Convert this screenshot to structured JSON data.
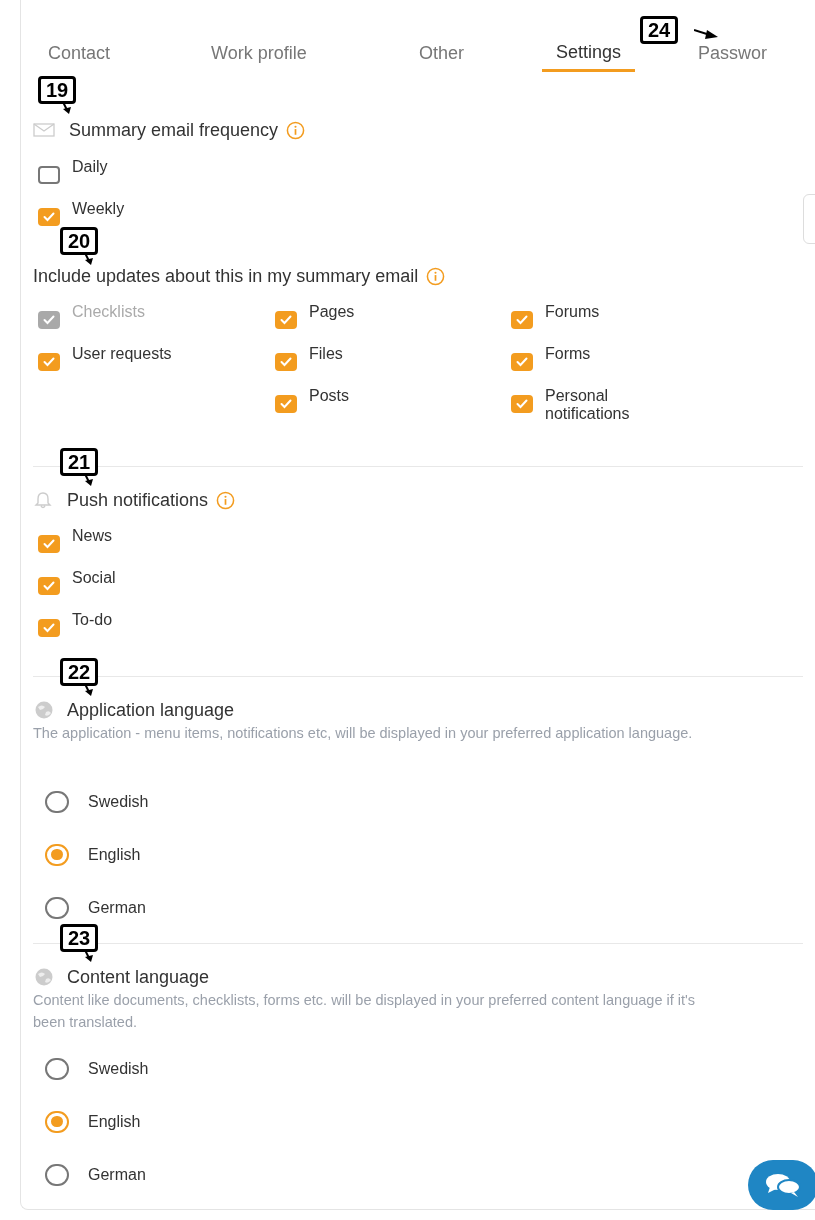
{
  "tabs": [
    {
      "label": "Contact",
      "selected": false
    },
    {
      "label": "Work profile",
      "selected": false
    },
    {
      "label": "Other",
      "selected": false
    },
    {
      "label": "Settings",
      "selected": true
    },
    {
      "label": "Passwor",
      "selected": false
    }
  ],
  "summary_frequency": {
    "title": "Summary email frequency",
    "options": [
      {
        "label": "Daily",
        "checked": false
      },
      {
        "label": "Weekly",
        "checked": true
      }
    ]
  },
  "include_updates": {
    "title": "Include updates about this in my summary email",
    "columns": [
      [
        {
          "label": "Checklists",
          "checked": true,
          "disabled": true
        },
        {
          "label": "User requests",
          "checked": true,
          "disabled": false
        }
      ],
      [
        {
          "label": "Pages",
          "checked": true,
          "disabled": false
        },
        {
          "label": "Files",
          "checked": true,
          "disabled": false
        },
        {
          "label": "Posts",
          "checked": true,
          "disabled": false
        }
      ],
      [
        {
          "label": "Forums",
          "checked": true,
          "disabled": false
        },
        {
          "label": "Forms",
          "checked": true,
          "disabled": false
        },
        {
          "label": "Personal notifications",
          "checked": true,
          "disabled": false
        }
      ]
    ]
  },
  "push_notifications": {
    "title": "Push notifications",
    "options": [
      {
        "label": "News",
        "checked": true
      },
      {
        "label": "Social",
        "checked": true
      },
      {
        "label": "To-do",
        "checked": true
      }
    ]
  },
  "application_language": {
    "title": "Application language",
    "description": "The application - menu items, notifications etc, will be displayed in your preferred application language.",
    "options": [
      {
        "label": "Swedish",
        "selected": false
      },
      {
        "label": "English",
        "selected": true
      },
      {
        "label": "German",
        "selected": false
      }
    ]
  },
  "content_language": {
    "title": "Content language",
    "description": "Content like documents, checklists, forms etc. will be displayed in your preferred content language if it's been translated.",
    "options": [
      {
        "label": "Swedish",
        "selected": false
      },
      {
        "label": "English",
        "selected": true
      },
      {
        "label": "German",
        "selected": false
      }
    ]
  },
  "callouts": [
    {
      "label": "19"
    },
    {
      "label": "20"
    },
    {
      "label": "21"
    },
    {
      "label": "22"
    },
    {
      "label": "23"
    },
    {
      "label": "24"
    }
  ]
}
